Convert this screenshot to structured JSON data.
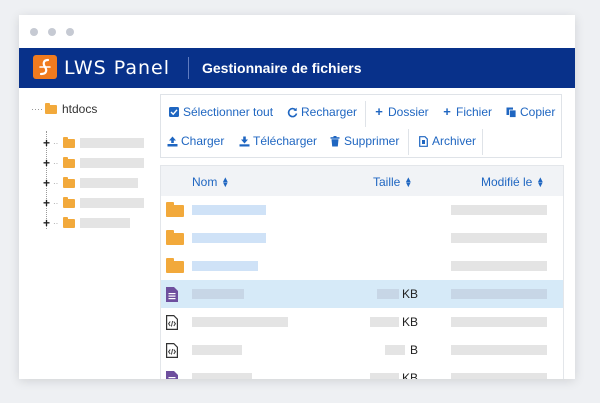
{
  "window": {
    "app_name": "LWS Panel",
    "title": "Gestionnaire de fichiers"
  },
  "tree": {
    "root_label": "htdocs",
    "children_count_note": ""
  },
  "toolbar": {
    "row1": [
      {
        "label": "Sélectionner tout",
        "icon": "check-square-icon"
      },
      {
        "label": "Recharger",
        "icon": "refresh-icon"
      },
      {
        "label": "Dossier",
        "icon": "plus-icon"
      },
      {
        "label": "Fichier",
        "icon": "plus-icon"
      },
      {
        "label": "Copier",
        "icon": "copy-icon"
      }
    ],
    "row2": [
      {
        "label": "Charger",
        "icon": "upload-icon"
      },
      {
        "label": "Télécharger",
        "icon": "download-icon"
      },
      {
        "label": "Supprimer",
        "icon": "trash-icon"
      },
      {
        "label": "Archiver",
        "icon": "archive-file-icon"
      }
    ]
  },
  "table": {
    "columns": {
      "name": "Nom",
      "size": "Taille",
      "modified": "Modifié le"
    },
    "rows": [
      {
        "type": "folder",
        "size_unit": ""
      },
      {
        "type": "folder",
        "size_unit": ""
      },
      {
        "type": "folder",
        "size_unit": ""
      },
      {
        "type": "text-file",
        "size_unit": "KB",
        "selected": true
      },
      {
        "type": "code-file",
        "size_unit": "KB"
      },
      {
        "type": "code-file",
        "size_unit": "B"
      },
      {
        "type": "text-file",
        "size_unit": "KB"
      }
    ]
  },
  "colors": {
    "header_bg": "#08318a",
    "brand_orange": "#f07b1e",
    "link_blue": "#1f66c1",
    "selected_row": "#d6eaf8",
    "folder": "#f2a93b",
    "file_purple": "#6e4f9e"
  }
}
